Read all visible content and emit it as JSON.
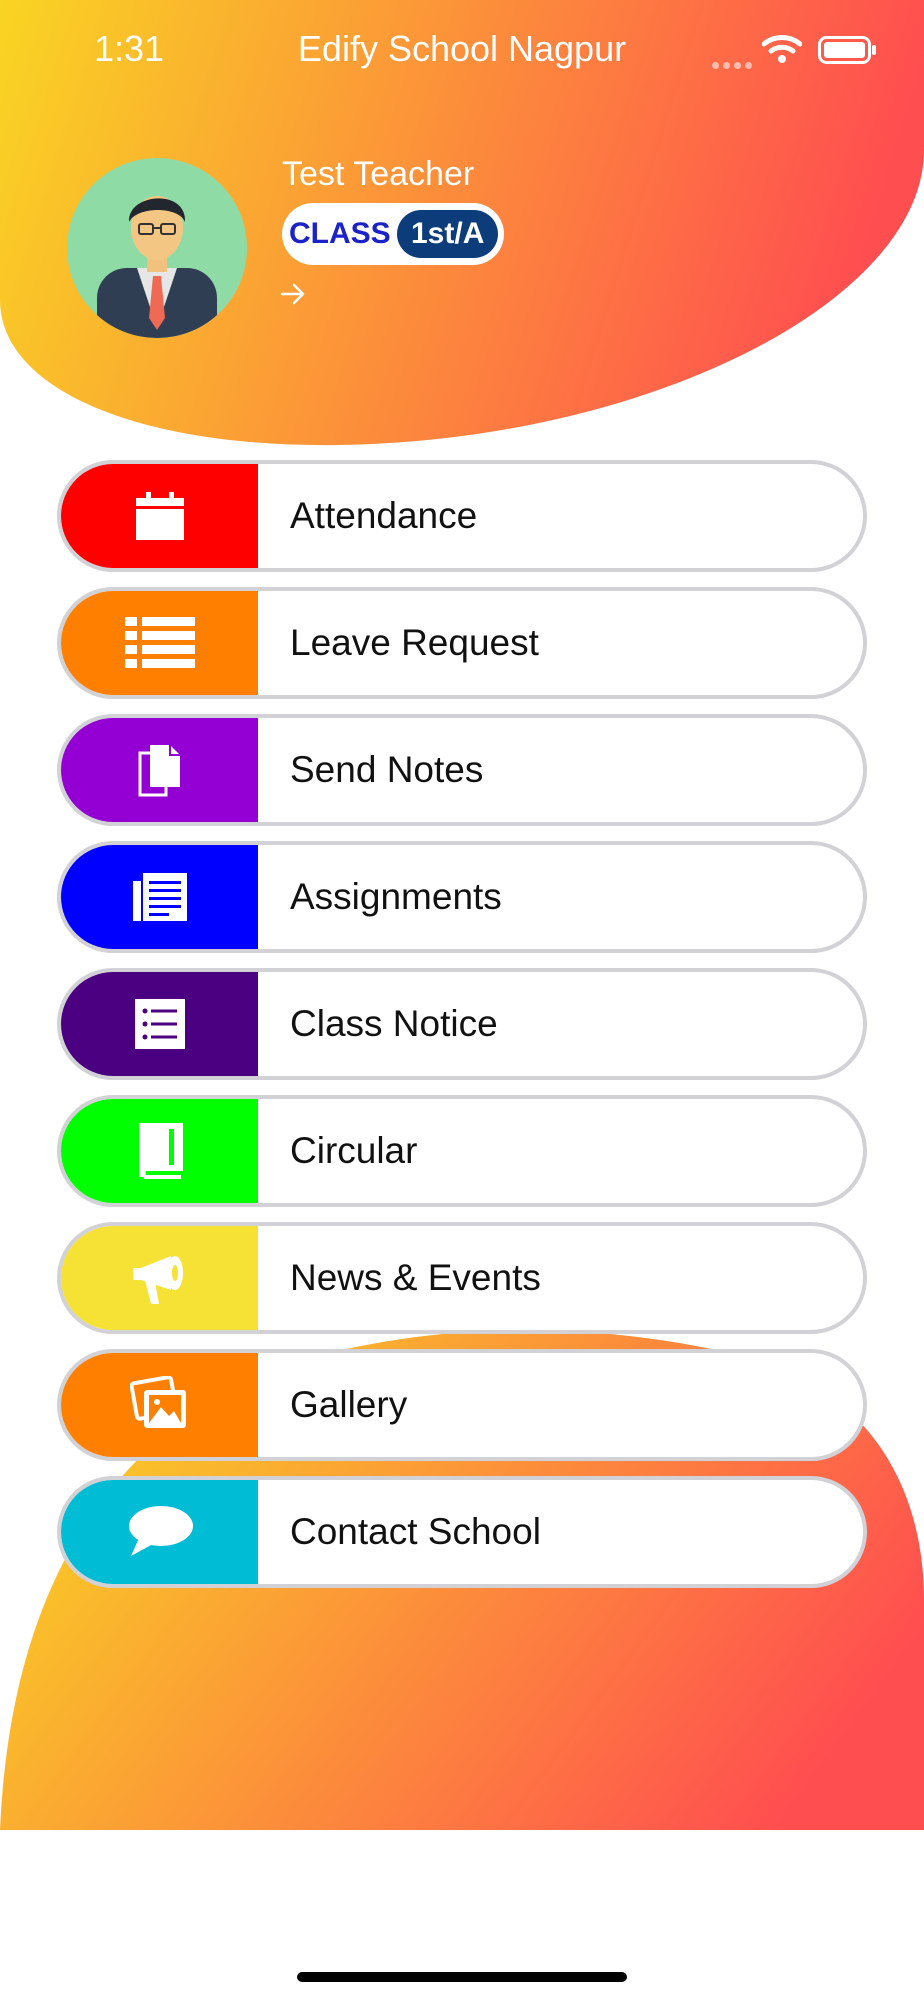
{
  "status_bar": {
    "time": "1:31",
    "app_title": "Edify School Nagpur"
  },
  "profile": {
    "name": "Test Teacher",
    "class_label": "CLASS",
    "class_value": "1st/A",
    "avatar_icon": "teacher-avatar-icon",
    "arrow_icon": "arrow-right-icon"
  },
  "colors": {
    "gradient_start": "#f9d423",
    "gradient_end": "#ff4e50",
    "class_value_bg": "#0d3c7a",
    "class_label": "#1b22c9"
  },
  "menu": {
    "items": [
      {
        "label": "Attendance",
        "color": "#ff0000",
        "icon": "calendar-icon"
      },
      {
        "label": "Leave Request",
        "color": "#ff7f00",
        "icon": "list-icon"
      },
      {
        "label": "Send Notes",
        "color": "#9400d3",
        "icon": "documents-icon"
      },
      {
        "label": "Assignments",
        "color": "#0000ff",
        "icon": "newspaper-icon"
      },
      {
        "label": "Class Notice",
        "color": "#4b0082",
        "icon": "notice-list-icon"
      },
      {
        "label": "Circular",
        "color": "#00ff00",
        "icon": "book-icon"
      },
      {
        "label": "News & Events",
        "color": "#f5e235",
        "icon": "megaphone-icon"
      },
      {
        "label": "Gallery",
        "color": "#ff7f00",
        "icon": "gallery-icon"
      },
      {
        "label": "Contact School",
        "color": "#00bcd4",
        "icon": "chat-bubble-icon"
      }
    ]
  }
}
